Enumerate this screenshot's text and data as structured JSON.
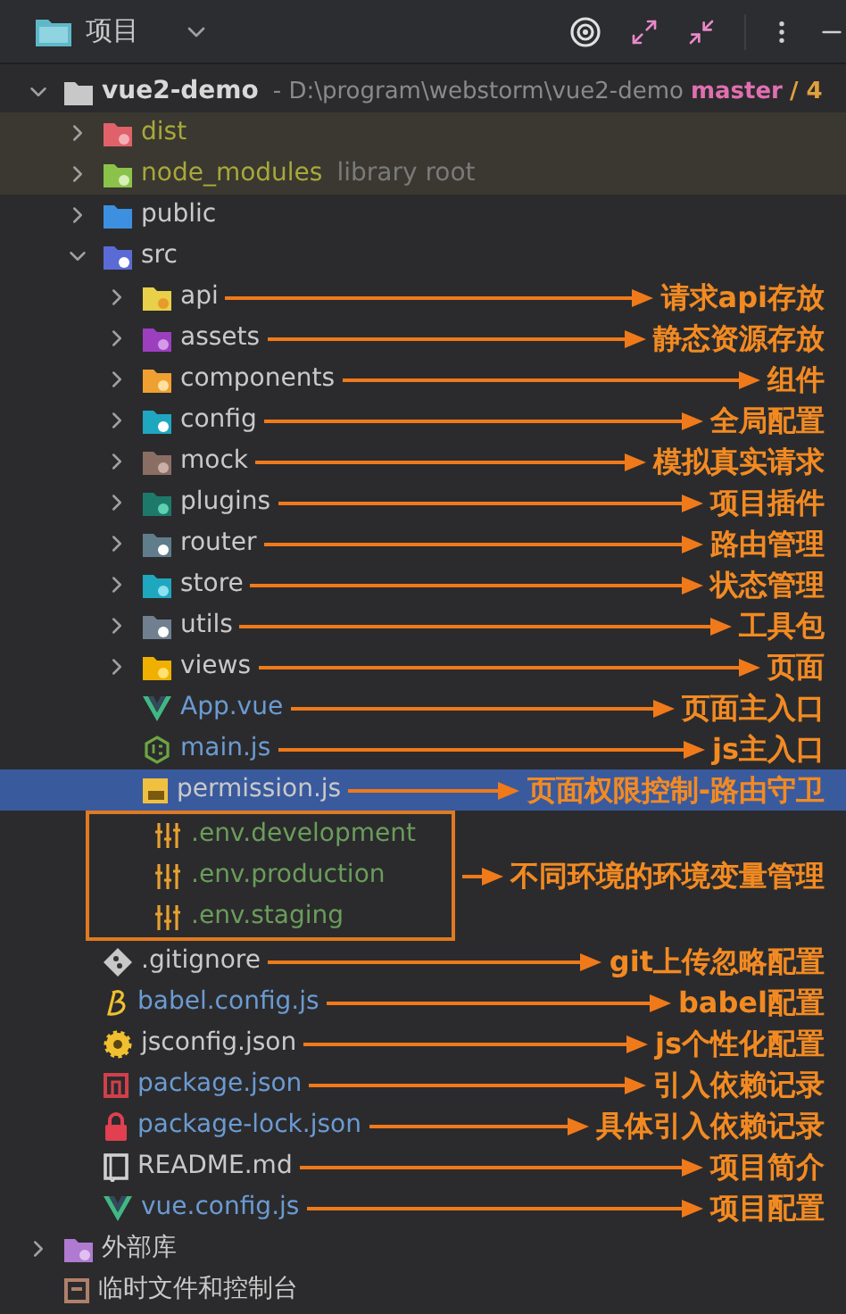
{
  "header": {
    "title": "项目"
  },
  "root": {
    "name": "vue2-demo",
    "path": "- D:\\program\\webstorm\\vue2-demo",
    "branch": "master",
    "branch_tail": "/ 4",
    "expanded": true,
    "selected": false
  },
  "tree": [
    {
      "kind": "excluded",
      "name": "dist",
      "excluded": true,
      "modified": false,
      "added": false,
      "expanded": false,
      "selected": false
    },
    {
      "kind": "library",
      "name": "node_modules",
      "suffix": "library root",
      "excluded": true,
      "modified": false,
      "added": false,
      "expanded": false,
      "selected": false
    },
    {
      "kind": "web",
      "name": "public",
      "excluded": false,
      "modified": false,
      "added": false,
      "expanded": false,
      "selected": false
    },
    {
      "kind": "source",
      "name": "src",
      "excluded": false,
      "modified": false,
      "added": false,
      "expanded": true,
      "selected": false,
      "children": [
        {
          "kind": "api",
          "name": "api",
          "excluded": false,
          "modified": false,
          "added": false,
          "expanded": false,
          "selected": false,
          "note": "请求api存放"
        },
        {
          "kind": "assets",
          "name": "assets",
          "excluded": false,
          "modified": false,
          "added": false,
          "expanded": false,
          "selected": false,
          "note": "静态资源存放"
        },
        {
          "kind": "components",
          "name": "components",
          "excluded": false,
          "modified": false,
          "added": false,
          "expanded": false,
          "selected": false,
          "note": "组件"
        },
        {
          "kind": "config",
          "name": "config",
          "excluded": false,
          "modified": false,
          "added": false,
          "expanded": false,
          "selected": false,
          "note": "全局配置"
        },
        {
          "kind": "mock",
          "name": "mock",
          "excluded": false,
          "modified": false,
          "added": false,
          "expanded": false,
          "selected": false,
          "note": "模拟真实请求"
        },
        {
          "kind": "plugins",
          "name": "plugins",
          "excluded": false,
          "modified": false,
          "added": false,
          "expanded": false,
          "selected": false,
          "note": "项目插件"
        },
        {
          "kind": "router",
          "name": "router",
          "excluded": false,
          "modified": false,
          "added": false,
          "expanded": false,
          "selected": false,
          "note": "路由管理"
        },
        {
          "kind": "store",
          "name": "store",
          "excluded": false,
          "modified": false,
          "added": false,
          "expanded": false,
          "selected": false,
          "note": "状态管理"
        },
        {
          "kind": "utils",
          "name": "utils",
          "excluded": false,
          "modified": false,
          "added": false,
          "expanded": false,
          "selected": false,
          "note": "工具包"
        },
        {
          "kind": "views",
          "name": "views",
          "excluded": false,
          "modified": false,
          "added": false,
          "expanded": false,
          "selected": false,
          "note": "页面"
        },
        {
          "kind": "vue",
          "name": "App.vue",
          "excluded": false,
          "modified": true,
          "added": false,
          "selected": false,
          "note": "页面主入口"
        },
        {
          "kind": "node",
          "name": "main.js",
          "excluded": false,
          "modified": true,
          "added": false,
          "selected": false,
          "note": "js主入口"
        },
        {
          "kind": "js",
          "name": "permission.js",
          "excluded": false,
          "modified": false,
          "added": false,
          "selected": true,
          "note": "页面权限控制-路由守卫"
        }
      ]
    },
    {
      "kind": "group",
      "note": "不同环境的环境变量管理",
      "items": [
        {
          "kind": "env",
          "name": ".env.development",
          "excluded": false,
          "modified": false,
          "added": true,
          "selected": false
        },
        {
          "kind": "env",
          "name": ".env.production",
          "excluded": false,
          "modified": false,
          "added": true,
          "selected": false
        },
        {
          "kind": "env",
          "name": ".env.staging",
          "excluded": false,
          "modified": false,
          "added": true,
          "selected": false
        }
      ]
    },
    {
      "kind": "git",
      "name": ".gitignore",
      "excluded": false,
      "modified": false,
      "added": false,
      "selected": false,
      "note": "git上传忽略配置"
    },
    {
      "kind": "babel",
      "name": "babel.config.js",
      "excluded": false,
      "modified": true,
      "added": false,
      "selected": false,
      "note": "babel配置"
    },
    {
      "kind": "jsconfig",
      "name": "jsconfig.json",
      "excluded": false,
      "modified": false,
      "added": false,
      "selected": false,
      "note": "js个性化配置"
    },
    {
      "kind": "npm",
      "name": "package.json",
      "excluded": false,
      "modified": true,
      "added": false,
      "selected": false,
      "note": "引入依赖记录"
    },
    {
      "kind": "lock",
      "name": "package-lock.json",
      "excluded": false,
      "modified": true,
      "added": false,
      "selected": false,
      "note": "具体引入依赖记录"
    },
    {
      "kind": "readme",
      "name": "README.md",
      "excluded": false,
      "modified": false,
      "added": false,
      "selected": false,
      "note": "项目简介"
    },
    {
      "kind": "vue",
      "name": "vue.config.js",
      "excluded": false,
      "modified": true,
      "added": false,
      "selected": false,
      "note": "项目配置"
    }
  ],
  "extra": [
    {
      "kind": "external",
      "name": "外部库",
      "expanded": false,
      "selected": false
    },
    {
      "kind": "scratch",
      "name": "临时文件和控制台",
      "selected": false
    }
  ]
}
